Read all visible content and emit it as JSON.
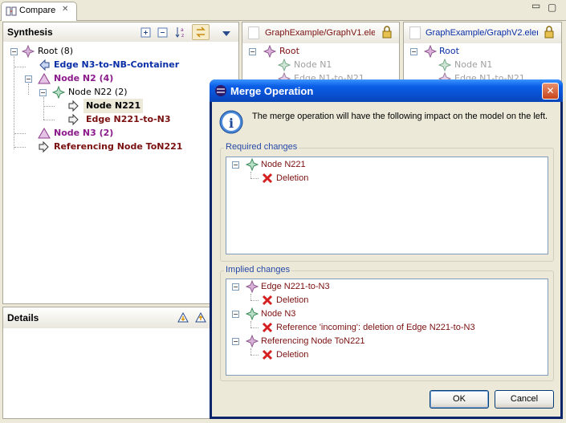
{
  "tab": {
    "title": "Compare",
    "close": "✕"
  },
  "window_controls": {
    "minimize": "▭",
    "maximize": "▢"
  },
  "synthesis": {
    "title": "Synthesis",
    "tree": [
      {
        "label": "Root (8)",
        "color": "#000000",
        "bold": false
      },
      {
        "label": "Edge N3-to-NB-Container",
        "color": "#0a2fa6",
        "bold": true
      },
      {
        "label": "Node N2 (4)",
        "color": "#8b1a8b",
        "bold": true
      },
      {
        "label": "Node N22 (2)",
        "color": "#000000",
        "bold": false
      },
      {
        "label": "Node N221",
        "color": "#000000",
        "bold": true
      },
      {
        "label": "Edge N221-to-N3",
        "color": "#7a1010",
        "bold": true
      },
      {
        "label": "Node N3 (2)",
        "color": "#8b1a8b",
        "bold": true
      },
      {
        "label": "Referencing Node ToN221",
        "color": "#7a1010",
        "bold": true
      }
    ]
  },
  "details": {
    "title": "Details"
  },
  "left_model": {
    "title": "GraphExample/GraphV1.elem",
    "tree": [
      "Root",
      "Node N1",
      "Edge N1-to-N21"
    ]
  },
  "right_model": {
    "title": "GraphExample/GraphV2.elem",
    "tree": [
      "Root",
      "Node N1",
      "Edge N1-to-N21"
    ]
  },
  "dialog": {
    "title": "Merge Operation",
    "close": "✕",
    "message": "The merge operation will have the following impact on the model on the left.",
    "required_label": "Required changes",
    "required": [
      {
        "label": "Node N221",
        "level": 0,
        "kind": "node"
      },
      {
        "label": "Deletion",
        "level": 1,
        "kind": "delete"
      }
    ],
    "implied_label": "Implied changes",
    "implied": [
      {
        "label": "Edge N221-to-N3",
        "level": 0,
        "kind": "edge"
      },
      {
        "label": "Deletion",
        "level": 1,
        "kind": "delete"
      },
      {
        "label": "Node N3",
        "level": 0,
        "kind": "node"
      },
      {
        "label": "Reference 'incoming': deletion of Edge N221-to-N3",
        "level": 1,
        "kind": "delete"
      },
      {
        "label": "Referencing Node ToN221",
        "level": 0,
        "kind": "edge"
      },
      {
        "label": "Deletion",
        "level": 1,
        "kind": "delete"
      }
    ],
    "ok": "OK",
    "cancel": "Cancel"
  },
  "colors": {
    "title_bar": "#0a246a",
    "dialog_text": "#7a1010",
    "group_label": "#2649a8",
    "delete": "#d42020"
  }
}
